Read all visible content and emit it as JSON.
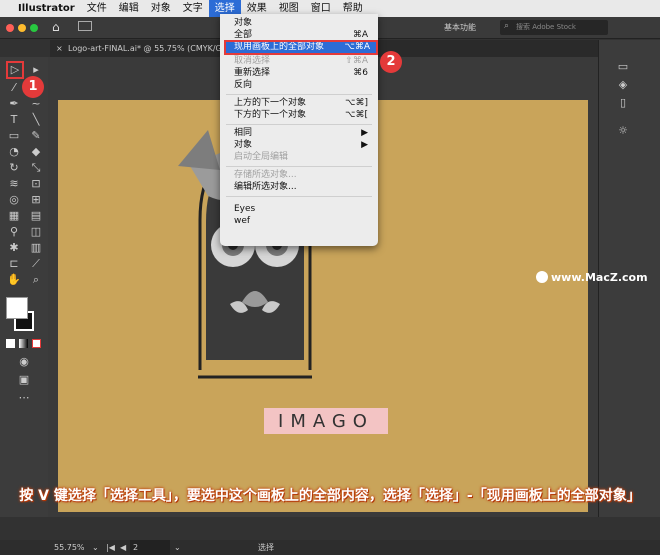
{
  "menubar": {
    "apple": "",
    "app": "Illustrator",
    "items": [
      "文件",
      "编辑",
      "对象",
      "文字",
      "选择",
      "效果",
      "视图",
      "窗口",
      "帮助"
    ]
  },
  "appbar": {
    "workspace": "基本功能",
    "search_placeholder": "搜索 Adobe Stock"
  },
  "doc_tab": {
    "close": "×",
    "title": "Logo-art-FINAL.ai* @ 55.75% (CMYK/GPU 预"
  },
  "select_menu": {
    "items": [
      {
        "label": "对象",
        "shortcut": "",
        "disabled": false
      },
      {
        "label": "全部",
        "shortcut": "⌘A",
        "disabled": false
      },
      {
        "label": "现用画板上的全部对象",
        "shortcut": "⌥⌘A",
        "highlighted": true
      },
      {
        "label": "取消选择",
        "shortcut": "⇧⌘A",
        "disabled": true
      },
      {
        "label": "重新选择",
        "shortcut": "⌘6",
        "disabled": false
      },
      {
        "label": "反向",
        "shortcut": "",
        "disabled": false
      },
      {
        "label": "上方的下一个对象",
        "shortcut": "⌥⌘]",
        "disabled": false
      },
      {
        "label": "下方的下一个对象",
        "shortcut": "⌥⌘[",
        "disabled": false
      },
      {
        "label": "相同",
        "shortcut": "▶",
        "disabled": false
      },
      {
        "label": "对象",
        "shortcut": "▶",
        "disabled": false
      },
      {
        "label": "启动全局编辑",
        "shortcut": "",
        "disabled": true
      },
      {
        "label": "存储所选对象...",
        "shortcut": "",
        "disabled": true
      },
      {
        "label": "编辑所选对象...",
        "shortcut": "",
        "disabled": false
      },
      {
        "label": "Eyes",
        "shortcut": "",
        "disabled": false
      },
      {
        "label": "wef",
        "shortcut": "",
        "disabled": false
      }
    ]
  },
  "badges": {
    "one": "1",
    "two": "2"
  },
  "artwork": {
    "logo_text": "IMAGO"
  },
  "watermark": "www.MacZ.com",
  "caption": "按 V 键选择「选择工具」，要选中这个画板上的全部内容，选择「选择」-「现用画板上的全部对象」",
  "status": {
    "zoom": "55.75%",
    "artboard": "2",
    "tool": "选择"
  },
  "colors": {
    "artboard": "#c9a45a",
    "accent": "#2c6cd6",
    "badge": "#e43a3a"
  }
}
